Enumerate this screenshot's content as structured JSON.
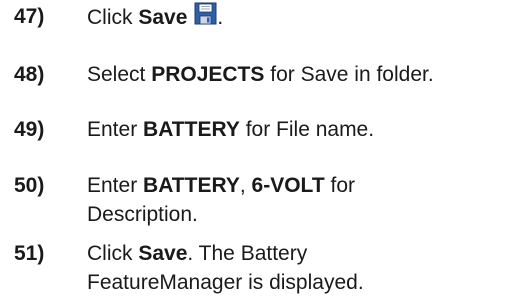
{
  "steps": [
    {
      "number": "47)",
      "parts": [
        {
          "text": "Click ",
          "bold": false
        },
        {
          "text": "Save",
          "bold": true
        }
      ],
      "icon": "save-floppy-icon",
      "after_icon": "."
    },
    {
      "number": "48)",
      "parts": [
        {
          "text": "Select ",
          "bold": false
        },
        {
          "text": "PROJECTS",
          "bold": true
        },
        {
          "text": " for Save in folder.",
          "bold": false
        }
      ]
    },
    {
      "number": "49)",
      "parts": [
        {
          "text": "Enter ",
          "bold": false
        },
        {
          "text": "BATTERY",
          "bold": true
        },
        {
          "text": " for File name.",
          "bold": false
        }
      ]
    },
    {
      "number": "50)",
      "parts": [
        {
          "text": "Enter ",
          "bold": false
        },
        {
          "text": "BATTERY",
          "bold": true
        },
        {
          "text": ", ",
          "bold": false
        },
        {
          "text": "6-VOLT",
          "bold": true
        },
        {
          "text": " for",
          "bold": false
        }
      ],
      "line2": "Description."
    },
    {
      "number": "51)",
      "parts": [
        {
          "text": "Click ",
          "bold": false
        },
        {
          "text": "Save",
          "bold": true
        },
        {
          "text": ". The Battery",
          "bold": false
        }
      ],
      "line2": "FeatureManager is displayed."
    }
  ]
}
